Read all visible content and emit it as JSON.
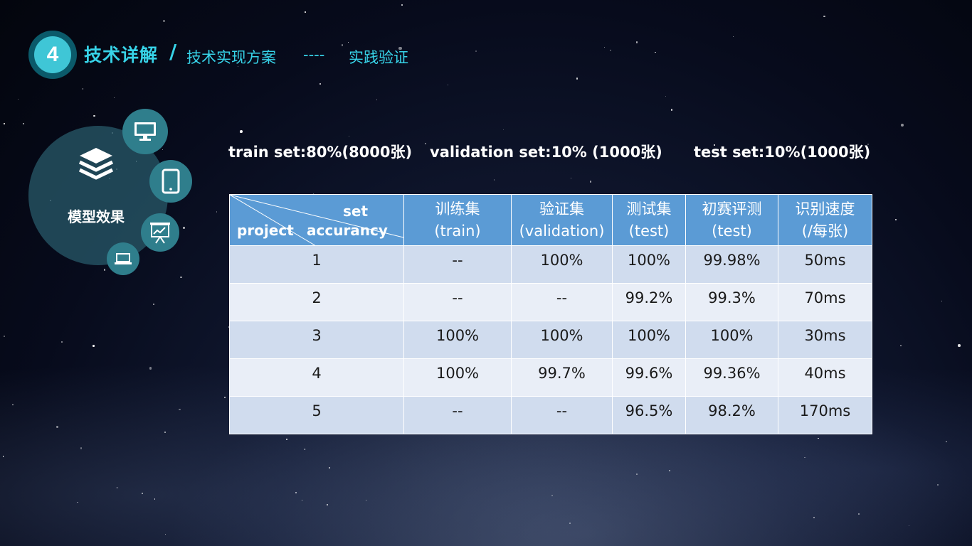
{
  "header": {
    "section_number": "4",
    "title": "技术详解",
    "slash": "/",
    "subtitle": "技术实现方案",
    "dashes": "----",
    "subtitle2": "实践验证"
  },
  "side_panel": {
    "label": "模型效果",
    "icons": [
      "layers-icon",
      "monitor-icon",
      "tablet-icon",
      "presentation-icon",
      "laptop-icon"
    ]
  },
  "info": {
    "train": "train set:80%(8000张)",
    "validation": "validation set:10% (1000张)",
    "test": "test set:10%(1000张)"
  },
  "table": {
    "corner": {
      "set": "set",
      "project": "project",
      "accuracy": "accurancy"
    },
    "columns": [
      {
        "cn": "训练集",
        "en": "(train)"
      },
      {
        "cn": "验证集",
        "en": "(validation)"
      },
      {
        "cn": "测试集",
        "en": "(test)"
      },
      {
        "cn": "初赛评测",
        "en": "(test)"
      },
      {
        "cn": "识别速度",
        "en": "(/每张)"
      }
    ],
    "rows": [
      [
        "1",
        "--",
        "100%",
        "100%",
        "99.98%",
        "50ms"
      ],
      [
        "2",
        "--",
        "--",
        "99.2%",
        "99.3%",
        "70ms"
      ],
      [
        "3",
        "100%",
        "100%",
        "100%",
        "100%",
        "30ms"
      ],
      [
        "4",
        "100%",
        "99.7%",
        "99.6%",
        "99.36%",
        "40ms"
      ],
      [
        "5",
        "--",
        "--",
        "96.5%",
        "98.2%",
        "170ms"
      ]
    ]
  },
  "colors": {
    "accent": "#37d3e8",
    "header_fill": "#5b9bd5",
    "row_dark": "#d0dcee",
    "row_light": "#e9eef7"
  }
}
